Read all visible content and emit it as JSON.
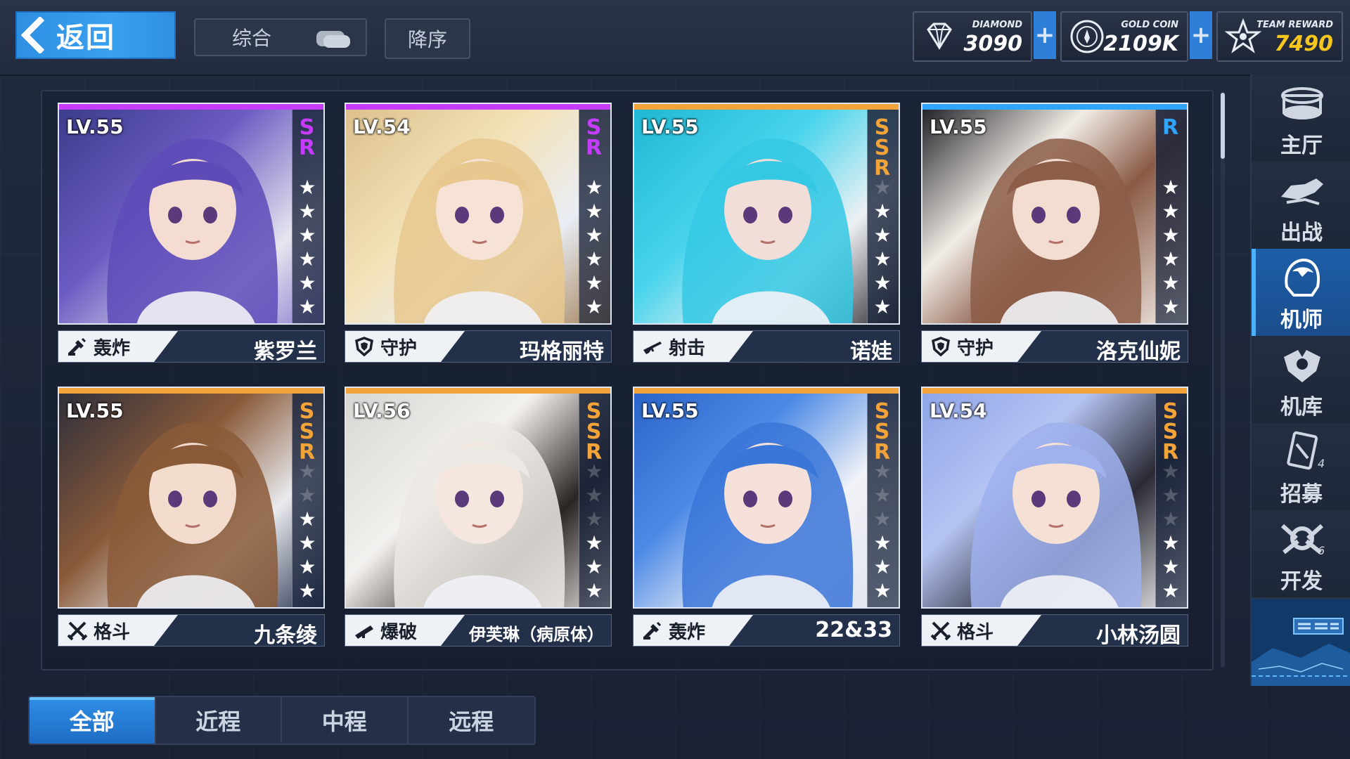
{
  "header": {
    "back_label": "返回",
    "sort_label": "综合",
    "order_label": "降序"
  },
  "resources": {
    "diamond": {
      "label": "DIAMOND",
      "value": "3090"
    },
    "gold": {
      "label": "GOLD COIN",
      "value": "2109K"
    },
    "team_reward": {
      "label": "TEAM REWARD",
      "value": "7490"
    }
  },
  "pilots": [
    {
      "level": "LV.55",
      "rarity": "SR",
      "rarity_color": "#c63cff",
      "stars": 6,
      "max_stars": 6,
      "class": "轰炸",
      "class_icon": "bomb-icon",
      "name": "紫罗兰"
    },
    {
      "level": "LV.54",
      "rarity": "SR",
      "rarity_color": "#c63cff",
      "stars": 6,
      "max_stars": 6,
      "class": "守护",
      "class_icon": "shield-icon",
      "name": "玛格丽特"
    },
    {
      "level": "LV.55",
      "rarity": "SSR",
      "rarity_color": "#f2a33a",
      "stars": 5,
      "max_stars": 6,
      "class": "射击",
      "class_icon": "rifle-icon",
      "name": "诺娃"
    },
    {
      "level": "LV.55",
      "rarity": "R",
      "rarity_color": "#2fa5ff",
      "stars": 6,
      "max_stars": 6,
      "class": "守护",
      "class_icon": "shield-icon",
      "name": "洛克仙妮"
    },
    {
      "level": "LV.55",
      "rarity": "SSR",
      "rarity_color": "#f2a33a",
      "stars": 4,
      "max_stars": 6,
      "class": "格斗",
      "class_icon": "crossed-swords-icon",
      "name": "九条绫"
    },
    {
      "level": "LV.56",
      "rarity": "SSR",
      "rarity_color": "#f2a33a",
      "stars": 3,
      "max_stars": 6,
      "class": "爆破",
      "class_icon": "bazooka-icon",
      "name": "伊芙琳（病原体）"
    },
    {
      "level": "LV.55",
      "rarity": "SSR",
      "rarity_color": "#f2a33a",
      "stars": 3,
      "max_stars": 6,
      "class": "轰炸",
      "class_icon": "bomb-icon",
      "name": "22&33"
    },
    {
      "level": "LV.54",
      "rarity": "SSR",
      "rarity_color": "#f2a33a",
      "stars": 3,
      "max_stars": 6,
      "class": "格斗",
      "class_icon": "crossed-swords-icon",
      "name": "小林汤圆"
    }
  ],
  "sidenav": [
    {
      "label": "主厅",
      "icon": "hall-icon",
      "active": false
    },
    {
      "label": "出战",
      "icon": "sortie-icon",
      "active": false
    },
    {
      "label": "机师",
      "icon": "pilot-icon",
      "active": true
    },
    {
      "label": "机库",
      "icon": "hangar-icon",
      "active": false
    },
    {
      "label": "招募",
      "icon": "recruit-card-icon",
      "active": false,
      "badge": "4"
    },
    {
      "label": "开发",
      "icon": "wrench-gear-icon",
      "active": false,
      "badge": "6"
    }
  ],
  "tabs": [
    "全部",
    "近程",
    "中程",
    "远程"
  ],
  "active_tab": 0,
  "colors": {
    "accent": "#2e8fe3",
    "gold": "#f6c61f",
    "sr": "#c63cff",
    "ssr": "#f2a33a",
    "r": "#2fa5ff"
  }
}
